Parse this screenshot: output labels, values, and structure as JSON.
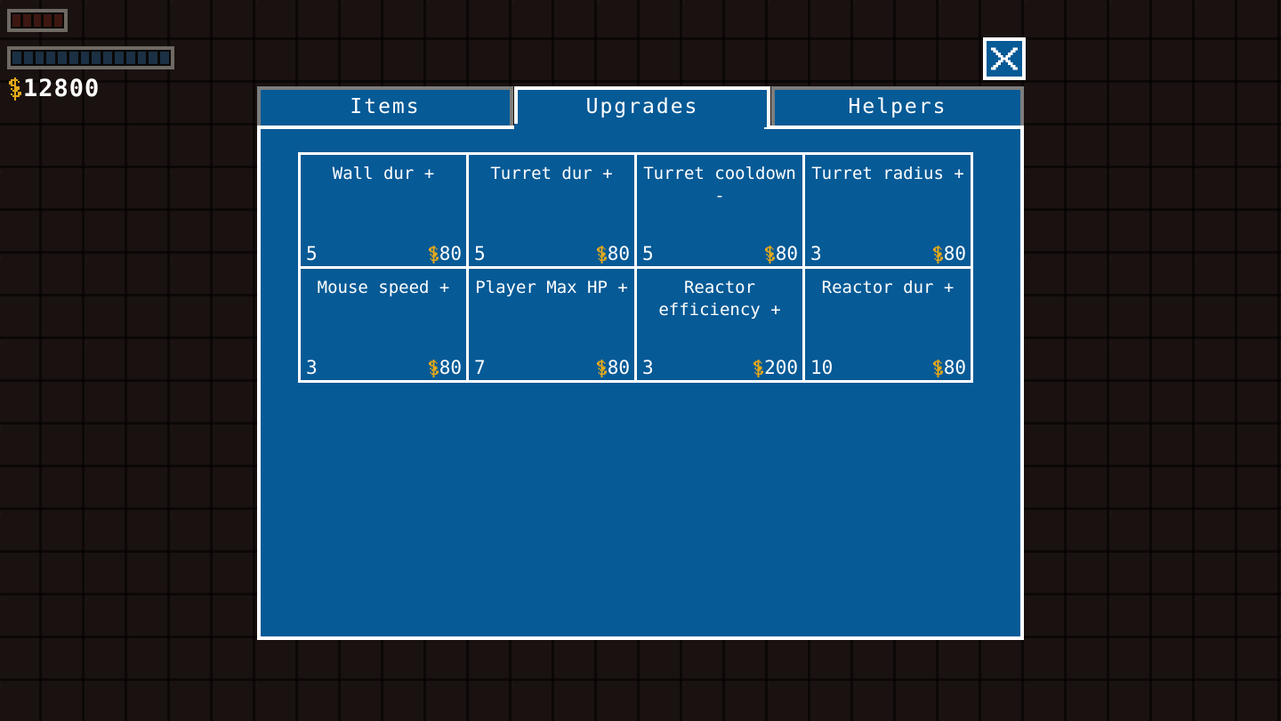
{
  "hud": {
    "health": {
      "name": "health-bar",
      "segments": 5,
      "filled": 0,
      "segment_color": "#3d1712",
      "frame_color": "#6e6963"
    },
    "energy": {
      "name": "energy-bar",
      "segments": 14,
      "filled": 14,
      "segment_color": "#1b3044",
      "frame_color": "#6e6963"
    },
    "money": {
      "icon": "coin-icon",
      "currency_symbol": "$",
      "amount": "12800",
      "color": "#ffffff",
      "icon_color": "#e3a81a"
    }
  },
  "close_button": {
    "icon": "close-x-icon",
    "label": "X"
  },
  "shop": {
    "accent_color": "#065a96",
    "border_active": "#ffffff",
    "border_inactive": "#7d7d7d",
    "tabs": [
      {
        "label": "Items",
        "active": false
      },
      {
        "label": "Upgrades",
        "active": true
      },
      {
        "label": "Helpers",
        "active": false
      }
    ],
    "active_tab": "Upgrades",
    "upgrades": [
      {
        "title": "Wall dur +",
        "level": "5",
        "price": "80",
        "currency": "$"
      },
      {
        "title": "Turret dur +",
        "level": "5",
        "price": "80",
        "currency": "$"
      },
      {
        "title": "Turret cooldown -",
        "level": "5",
        "price": "80",
        "currency": "$"
      },
      {
        "title": "Turret radius +",
        "level": "3",
        "price": "80",
        "currency": "$"
      },
      {
        "title": "Mouse speed +",
        "level": "3",
        "price": "80",
        "currency": "$"
      },
      {
        "title": "Player Max HP +",
        "level": "7",
        "price": "80",
        "currency": "$"
      },
      {
        "title": "Reactor efficiency +",
        "level": "3",
        "price": "200",
        "currency": "$"
      },
      {
        "title": "Reactor dur +",
        "level": "10",
        "price": "80",
        "currency": "$"
      }
    ]
  }
}
